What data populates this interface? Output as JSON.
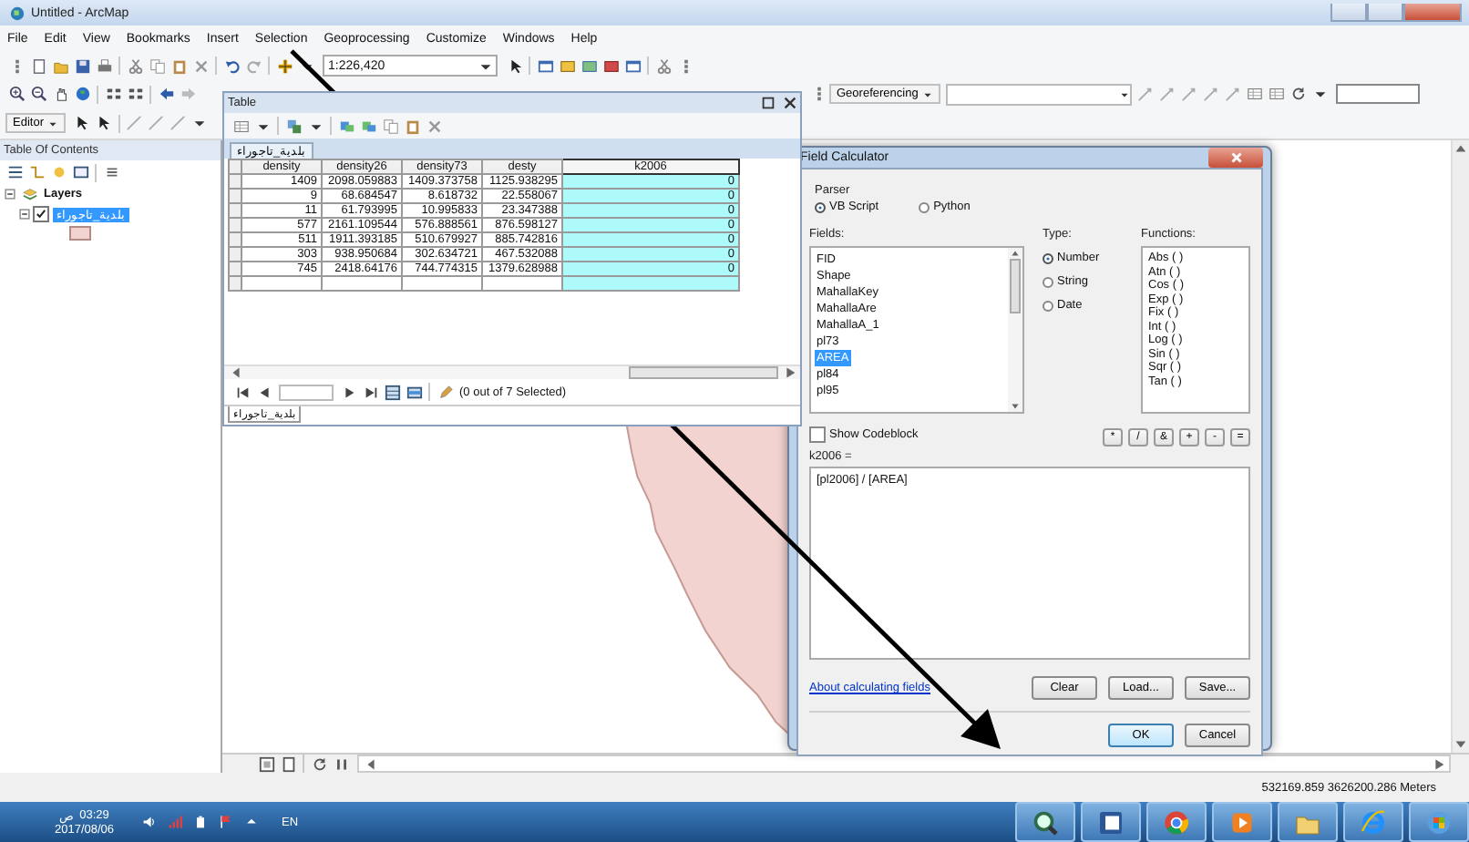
{
  "window": {
    "title": "Untitled - ArcMap"
  },
  "menu": [
    "File",
    "Edit",
    "View",
    "Bookmarks",
    "Insert",
    "Selection",
    "Geoprocessing",
    "Customize",
    "Windows",
    "Help"
  ],
  "toolbar": {
    "scale": "1:226,420",
    "editor": "Editor",
    "georeferencing": "Georeferencing"
  },
  "toc": {
    "title": "Table Of Contents",
    "tree": [
      {
        "kind": "data_frame",
        "label": "Layers",
        "expanded": true,
        "selected": false,
        "children": [
          {
            "kind": "layer",
            "label": "بلدية_تاجوراء",
            "expanded": true,
            "checked": true,
            "selected": true
          }
        ]
      }
    ]
  },
  "table": {
    "title": "Table",
    "layer_tab": "بلدية_تاجوراء",
    "columns": [
      {
        "label": "density",
        "selected": false
      },
      {
        "label": "density26",
        "selected": false
      },
      {
        "label": "density73",
        "selected": false
      },
      {
        "label": "desty",
        "selected": false
      },
      {
        "label": "k2006",
        "selected": true
      }
    ],
    "rows": [
      [
        "1409",
        "2098.059883",
        "1409.373758",
        "1125.938295",
        "0"
      ],
      [
        "9",
        "68.684547",
        "8.618732",
        "22.558067",
        "0"
      ],
      [
        "11",
        "61.793995",
        "10.995833",
        "23.347388",
        "0"
      ],
      [
        "577",
        "2161.109544",
        "576.888561",
        "876.598127",
        "0"
      ],
      [
        "511",
        "1911.393185",
        "510.679927",
        "885.742816",
        "0"
      ],
      [
        "303",
        "938.950684",
        "302.634721",
        "467.532088",
        "0"
      ],
      [
        "745",
        "2418.64176",
        "744.774315",
        "1379.628988",
        "0"
      ]
    ],
    "selection_status": "(0 out of 7 Selected)",
    "bottom_tab": "بلدية_تاجوراء"
  },
  "field_calculator": {
    "title": "Field Calculator",
    "parser_label": "Parser",
    "parsers": [
      {
        "label": "VB Script",
        "selected": true
      },
      {
        "label": "Python",
        "selected": false
      }
    ],
    "fields_label": "Fields:",
    "fields": [
      {
        "label": "FID",
        "selected": false
      },
      {
        "label": "Shape",
        "selected": false
      },
      {
        "label": "MahallaKey",
        "selected": false
      },
      {
        "label": "MahallaAre",
        "selected": false
      },
      {
        "label": "MahallaA_1",
        "selected": false
      },
      {
        "label": "pl73",
        "selected": false
      },
      {
        "label": "AREA",
        "selected": true
      },
      {
        "label": "pl84",
        "selected": false
      },
      {
        "label": "pl95",
        "selected": false
      }
    ],
    "type_label": "Type:",
    "types": [
      {
        "label": "Number",
        "selected": true
      },
      {
        "label": "String",
        "selected": false
      },
      {
        "label": "Date",
        "selected": false
      }
    ],
    "functions_label": "Functions:",
    "functions": [
      "Abs ( )",
      "Atn ( )",
      "Cos ( )",
      "Exp ( )",
      "Fix ( )",
      "Int ( )",
      "Log ( )",
      "Sin ( )",
      "Sqr ( )",
      "Tan ( )"
    ],
    "show_codeblock": {
      "label": "Show Codeblock",
      "checked": false
    },
    "operators": [
      "*",
      "/",
      "&",
      "+",
      "-",
      "="
    ],
    "expression_label": "k2006 =",
    "expression": "[pl2006] / [AREA]",
    "help_link": "About calculating fields",
    "buttons": [
      "Clear",
      "Load...",
      "Save..."
    ],
    "footer_buttons": [
      "OK",
      "Cancel"
    ]
  },
  "status_bar": {
    "coordinates": "532169.859  3626200.286 Meters"
  },
  "taskbar": {
    "time": "03:29",
    "period": "ص",
    "date": "2017/08/06",
    "language": "EN"
  }
}
